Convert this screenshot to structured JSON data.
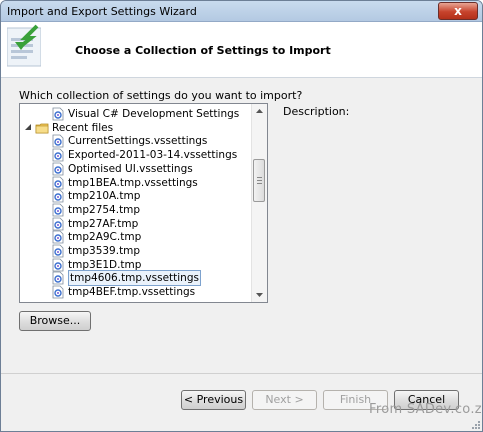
{
  "window": {
    "title": "Import and Export Settings Wizard",
    "close_glyph": "x"
  },
  "header": {
    "title": "Choose a Collection of Settings to Import"
  },
  "prompt": "Which collection of settings do you want to import?",
  "tree": {
    "items": [
      {
        "label": "Visual C# Development Settings",
        "type": "file",
        "indent": 1
      },
      {
        "label": "Recent files",
        "type": "folder",
        "indent": 0,
        "expanded": true
      },
      {
        "label": "CurrentSettings.vssettings",
        "type": "file",
        "indent": 1
      },
      {
        "label": "Exported-2011-03-14.vssettings",
        "type": "file",
        "indent": 1
      },
      {
        "label": "Optimised UI.vssettings",
        "type": "file",
        "indent": 1
      },
      {
        "label": "tmp1BEA.tmp.vssettings",
        "type": "file",
        "indent": 1
      },
      {
        "label": "tmp210A.tmp",
        "type": "file",
        "indent": 1
      },
      {
        "label": "tmp2754.tmp",
        "type": "file",
        "indent": 1
      },
      {
        "label": "tmp27AF.tmp",
        "type": "file",
        "indent": 1
      },
      {
        "label": "tmp2A9C.tmp",
        "type": "file",
        "indent": 1
      },
      {
        "label": "tmp3539.tmp",
        "type": "file",
        "indent": 1
      },
      {
        "label": "tmp3E1D.tmp",
        "type": "file",
        "indent": 1
      },
      {
        "label": "tmp4606.tmp.vssettings",
        "type": "file",
        "indent": 1,
        "selected": true
      },
      {
        "label": "tmp4BEF.tmp.vssettings",
        "type": "file",
        "indent": 1
      }
    ]
  },
  "description_label": "Description:",
  "buttons": {
    "browse": "Browse...",
    "previous": "< Previous",
    "next": "Next >",
    "finish": "Finish",
    "cancel": "Cancel"
  },
  "watermark": "From SADev.co.za",
  "colors": {
    "title_bar": "#b9cde5",
    "selection_border": "#7da2ce",
    "folder": "#f0c75a",
    "file_icon_accent": "#3a6fcf"
  }
}
